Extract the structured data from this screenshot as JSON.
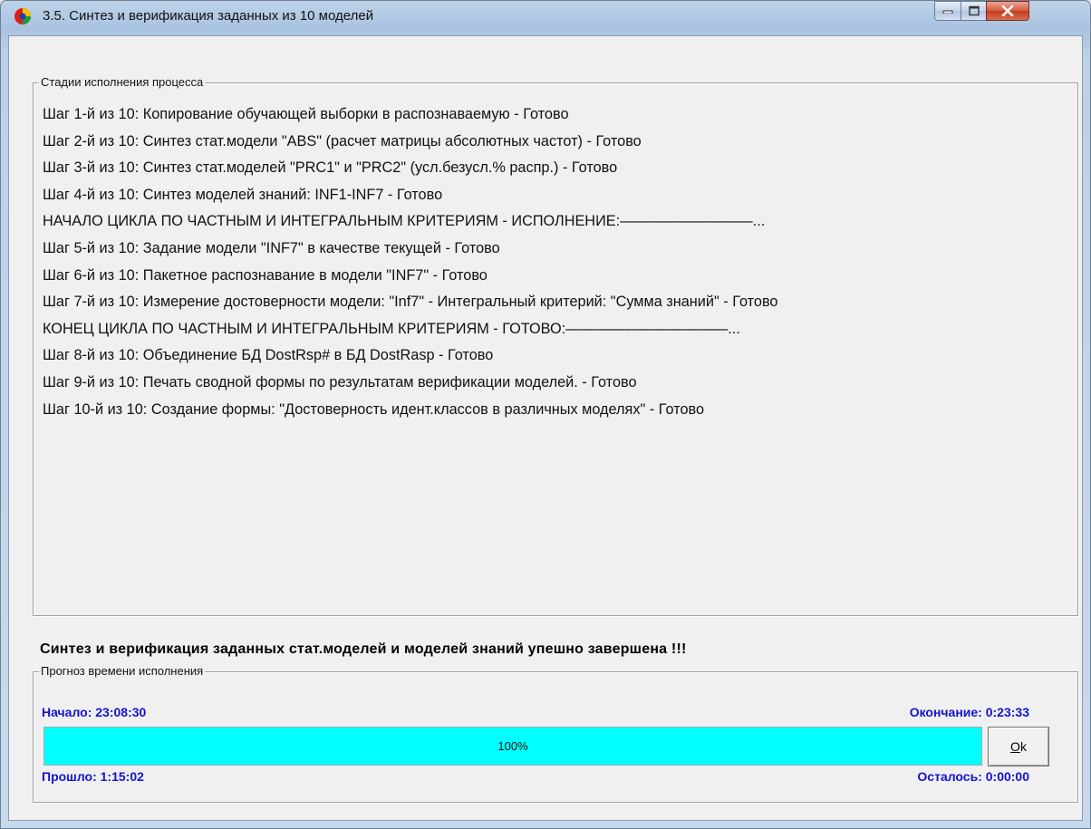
{
  "window": {
    "title": "3.5. Синтез и верификация заданных из 10 моделей"
  },
  "stages": {
    "legend": "Стадии исполнения процесса",
    "steps": [
      "Шаг 1-й из 10: Копирование обучающей выборки в распознаваемую - Готово",
      "Шаг 2-й из 10: Синтез стат.модели \"ABS\" (расчет матрицы абсолютных частот) - Готово",
      "Шаг 3-й из 10: Синтез стат.моделей \"PRC1\" и \"PRC2\" (усл.безусл.% распр.) - Готово",
      "Шаг 4-й из 10: Синтез моделей знаний: INF1-INF7 - Готово",
      "НАЧАЛО ЦИКЛА ПО ЧАСТНЫМ И ИНТЕГРАЛЬНЫМ КРИТЕРИЯМ - ИСПОЛНЕНИЕ:—————————...",
      "Шаг 5-й из 10: Задание модели \"INF7\" в качестве текущей - Готово",
      "Шаг 6-й из 10: Пакетное распознавание в модели \"INF7\" - Готово",
      "Шаг 7-й из 10: Измерение достоверности модели: \"Inf7\" - Интегральный критерий: \"Сумма знаний\" - Готово",
      "КОНЕЦ ЦИКЛА ПО ЧАСТНЫМ И ИНТЕГРАЛЬНЫМ КРИТЕРИЯМ - ГОТОВО:———————————...",
      "Шаг 8-й из 10: Объединение БД DostRsp# в БД DostRasp - Готово",
      "Шаг 9-й из 10: Печать сводной формы по результатам верификации моделей. - Готово",
      "Шаг 10-й из 10: Создание формы: \"Достоверность идент.классов в различных моделях\" - Готово"
    ]
  },
  "status_message": "Синтез и верификация заданных стат.моделей и моделей знаний упешно завершена !!!",
  "forecast": {
    "legend": "Прогноз времени исполнения",
    "start": "Начало: 23:08:30",
    "end": "Окончание: 0:23:33",
    "elapsed": "Прошло: 1:15:02",
    "remaining": "Осталось: 0:00:00",
    "progress_text": "100%",
    "progress_fraction": 1.0
  },
  "ok_button": {
    "accel": "O",
    "rest": "k"
  },
  "colors": {
    "progress_fill": "#00ffff",
    "time_labels": "#1414d2",
    "close_button": "#c43b1d"
  }
}
